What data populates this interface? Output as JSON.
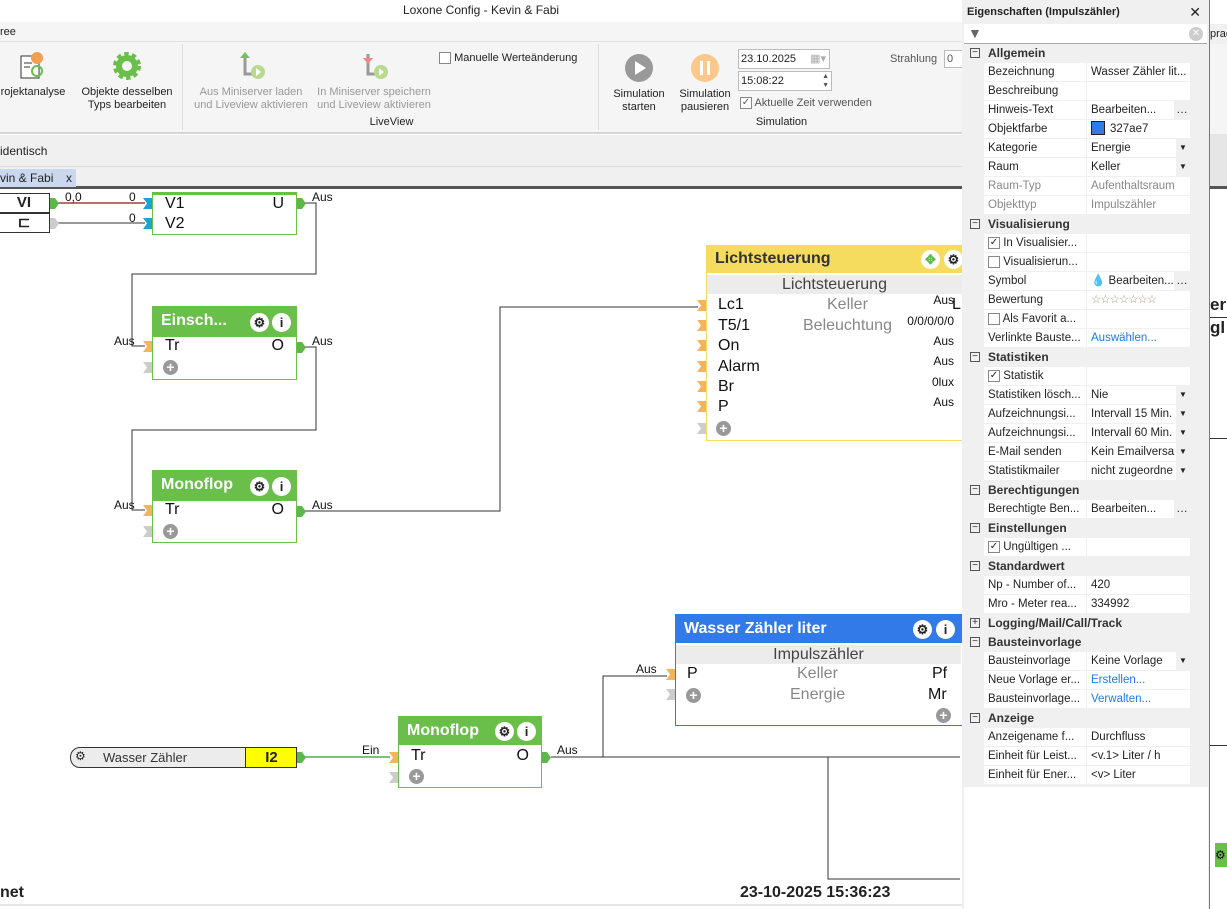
{
  "window": {
    "title": "Loxone Config - Kevin & Fabi"
  },
  "menu": {
    "partial_tab": "ree"
  },
  "ribbon": {
    "projektanalyse": "rojektanalyse",
    "objekte_bearbeiten": [
      "Objekte desselben",
      "Typs bearbeiten"
    ],
    "liveview": {
      "load": [
        "Aus Miniserver laden",
        "und Liveview aktivieren"
      ],
      "save": [
        "In Miniserver speichern",
        "und Liveview aktivieren"
      ],
      "manual_label": "Manuelle Werteänderung",
      "manual_checked": false,
      "group_label": "LiveView"
    },
    "simulation": {
      "start": [
        "Simulation",
        "starten"
      ],
      "pause": [
        "Simulation",
        "pausieren"
      ],
      "date": "23.10.2025",
      "time": "15:08:22",
      "current_time_label": "Aktuelle Zeit verwenden",
      "current_time_checked": true,
      "group_label": "Simulation"
    },
    "strahlung_label": "Strahlung",
    "strahlung_value": "0"
  },
  "subrow": {
    "text": "identisch"
  },
  "document_tab": {
    "label": "vin & Fabi",
    "close": "x"
  },
  "diagram": {
    "inputs": {
      "vi_label": "VI",
      "vi_value": "0,0"
    },
    "block1": {
      "in": [
        "V1",
        "V2"
      ],
      "in_values": [
        "0",
        "0"
      ],
      "out": "U",
      "out_value": "Aus"
    },
    "einsch": {
      "title": "Einsch...",
      "in": "Tr",
      "in_value": "Aus",
      "out": "O",
      "out_value": "Aus"
    },
    "monoflop1": {
      "title": "Monoflop",
      "in": "Tr",
      "in_value": "Aus",
      "out": "O",
      "out_value": "Aus"
    },
    "lichtsteuerung": {
      "title": "Lichtsteuerung",
      "subtitle": "Lichtsteuerung",
      "room": "Keller",
      "category": "Beleuchtung",
      "inputs": [
        {
          "name": "Lc1",
          "value": "Aus"
        },
        {
          "name": "T5/1",
          "value": "0/0/0/0/0"
        },
        {
          "name": "On",
          "value": "Aus"
        },
        {
          "name": "Alarm",
          "value": "Aus"
        },
        {
          "name": "Br",
          "value": "0lux"
        },
        {
          "name": "P",
          "value": "Aus"
        }
      ],
      "out_partial": "L",
      "color": "#f5dc5e"
    },
    "wasser_block": {
      "title": "Wasser Zähler liter",
      "subtitle": "Impulszähler",
      "room": "Keller",
      "category": "Energie",
      "in": "P",
      "in_value": "Aus",
      "outs": [
        "Pf",
        "Mr"
      ],
      "color": "#327ae7"
    },
    "wasser_input": {
      "label": "Wasser Zähler",
      "tag": "I2",
      "out_value": "Ein"
    },
    "monoflop2": {
      "title": "Monoflop",
      "in": "Tr",
      "in_value": "Ein",
      "out": "O",
      "out_value": "Aus"
    },
    "footer_left": "net",
    "footer_datetime": "23-10-2025 15:36:23"
  },
  "properties": {
    "title": "Eigenschaften (Impulszähler)",
    "sections": {
      "allgemein": "Allgemein",
      "visualisierung": "Visualisierung",
      "statistiken": "Statistiken",
      "berechtigungen": "Berechtigungen",
      "einstellungen": "Einstellungen",
      "standardwert": "Standardwert",
      "logging": "Logging/Mail/Call/Track",
      "bausteinvorlage": "Bausteinvorlage",
      "anzeige": "Anzeige"
    },
    "rows": {
      "bezeichnung": [
        "Bezeichnung",
        "Wasser Zähler lit..."
      ],
      "beschreibung": [
        "Beschreibung",
        ""
      ],
      "hinweis": [
        "Hinweis-Text",
        "Bearbeiten..."
      ],
      "objektfarbe": [
        "Objektfarbe",
        "327ae7"
      ],
      "kategorie": [
        "Kategorie",
        "Energie"
      ],
      "raum": [
        "Raum",
        "Keller"
      ],
      "raumtyp": [
        "Raum-Typ",
        "Aufenthaltsraum"
      ],
      "objekttyp": [
        "Objekttyp",
        "Impulszähler"
      ],
      "in_visu": "In Visualisier...",
      "visu2": "Visualisierun...",
      "symbol": [
        "Symbol",
        "Bearbeiten..."
      ],
      "bewertung": [
        "Bewertung",
        "☆☆☆☆☆☆☆"
      ],
      "favorit": "Als Favorit a...",
      "verlinkte": [
        "Verlinkte Bauste...",
        "Auswählen..."
      ],
      "statistik": "Statistik",
      "stat_loeschen": [
        "Statistiken lösch...",
        "Nie"
      ],
      "aufz1": [
        "Aufzeichnungsi...",
        "Intervall 15 Min."
      ],
      "aufz2": [
        "Aufzeichnungsi...",
        "Intervall 60 Min."
      ],
      "email": [
        "E-Mail senden",
        "Kein Emailversa"
      ],
      "statmailer": [
        "Statistikmailer",
        "nicht zugeordne"
      ],
      "berechtigte": [
        "Berechtigte Ben...",
        "Bearbeiten..."
      ],
      "ungueltigen": "Ungültigen ...",
      "np": [
        "Np - Number of...",
        "420"
      ],
      "mro": [
        "Mro - Meter rea...",
        "334992"
      ],
      "vorlage": [
        "Bausteinvorlage",
        "Keine Vorlage"
      ],
      "neue_vorlage": [
        "Neue Vorlage er...",
        "Erstellen..."
      ],
      "vorlage_verw": [
        "Bausteinvorlage...",
        "Verwalten..."
      ],
      "anzeigename": [
        "Anzeigename f...",
        "Durchfluss"
      ],
      "einheit_leist": [
        "Einheit für Leist...",
        "<v.1> Liter / h"
      ],
      "einheit_ener": [
        "Einheit für Ener...",
        "<v> Liter"
      ]
    },
    "checks": {
      "in_visu": true,
      "visu2": false,
      "favorit": false,
      "statistik": true,
      "ungueltigen": true
    },
    "object_color": "#327ae7"
  },
  "right_fragments": {
    "top": "prac",
    "mid1": "er",
    "mid2": "gl"
  }
}
